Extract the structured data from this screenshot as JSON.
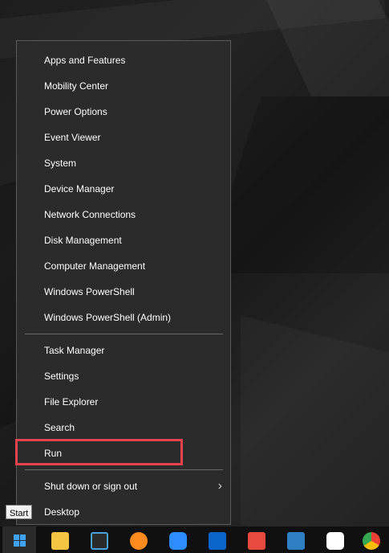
{
  "menu": {
    "group1": [
      {
        "label": "Apps and Features"
      },
      {
        "label": "Mobility Center"
      },
      {
        "label": "Power Options"
      },
      {
        "label": "Event Viewer"
      },
      {
        "label": "System"
      },
      {
        "label": "Device Manager"
      },
      {
        "label": "Network Connections"
      },
      {
        "label": "Disk Management"
      },
      {
        "label": "Computer Management"
      },
      {
        "label": "Windows PowerShell"
      },
      {
        "label": "Windows PowerShell (Admin)"
      }
    ],
    "group2": [
      {
        "label": "Task Manager"
      },
      {
        "label": "Settings"
      },
      {
        "label": "File Explorer"
      },
      {
        "label": "Search"
      },
      {
        "label": "Run"
      }
    ],
    "group3": [
      {
        "label": "Shut down or sign out",
        "arrow": "›"
      },
      {
        "label": "Desktop"
      }
    ]
  },
  "tooltip": {
    "text": "Start"
  },
  "highlight_color": "#e8424f",
  "taskbar": {
    "icons": [
      {
        "name": "start-icon",
        "color": "#3da3ff"
      },
      {
        "name": "file-explorer-icon",
        "color": "#f4c542"
      },
      {
        "name": "remote-desktop-icon",
        "color": "#4aa3df"
      },
      {
        "name": "firefox-icon",
        "color": "#ff8a1e"
      },
      {
        "name": "zoom-icon",
        "color": "#2d8cff"
      },
      {
        "name": "outlook-icon",
        "color": "#0a64c9"
      },
      {
        "name": "app-s-red-icon",
        "color": "#e94a3f"
      },
      {
        "name": "snagit-icon",
        "color": "#2f7fc4"
      },
      {
        "name": "slack-icon",
        "color": "#e01e5a"
      },
      {
        "name": "chrome-icon",
        "color": "#34a853"
      }
    ]
  }
}
